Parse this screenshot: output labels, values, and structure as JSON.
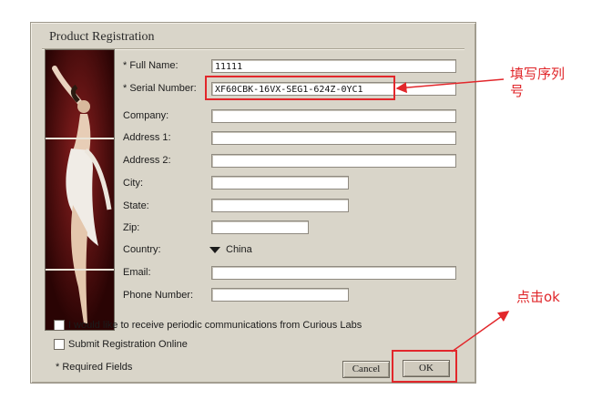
{
  "dialog": {
    "title": "Product Registration",
    "fields": [
      {
        "label": "* Full Name:",
        "value": "11111"
      },
      {
        "label": "* Serial Number:",
        "value": "XF60CBK-16VX-SEG1-624Z-0YC1"
      },
      {
        "label": "Company:",
        "value": ""
      },
      {
        "label": "Address 1:",
        "value": ""
      },
      {
        "label": "Address 2:",
        "value": ""
      },
      {
        "label": "City:",
        "value": ""
      },
      {
        "label": "State:",
        "value": ""
      },
      {
        "label": "Zip:",
        "value": ""
      },
      {
        "label": "Country:",
        "value": "China"
      },
      {
        "label": "Email:",
        "value": ""
      },
      {
        "label": "Phone Number:",
        "value": ""
      }
    ],
    "checkboxes": [
      {
        "label": "I would like to receive periodic communications from Curious Labs",
        "checked": false
      },
      {
        "label": "Submit Registration Online",
        "checked": false
      }
    ],
    "required_note": "* Required Fields",
    "cancel_label": "Cancel",
    "ok_label": "OK"
  },
  "annotations": {
    "serial_note": "填写序列号",
    "ok_note": "点击ok",
    "color": "#e2272b"
  }
}
